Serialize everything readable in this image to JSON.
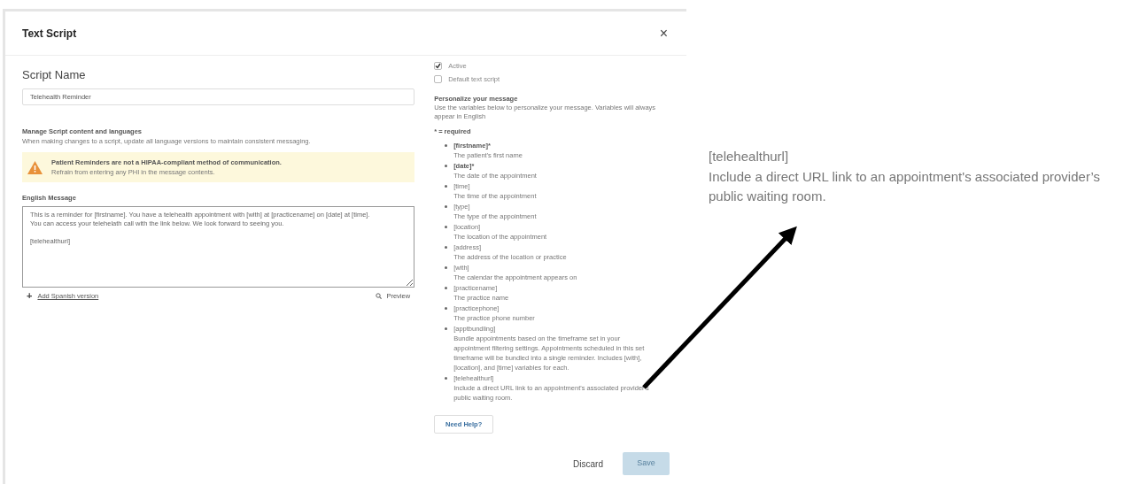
{
  "dialog": {
    "title": "Text Script",
    "close": "×"
  },
  "script_name": {
    "label": "Script Name",
    "value": "Telehealth Reminder"
  },
  "manage": {
    "title": "Manage Script content and languages",
    "text": "When making changes to a script, update all language versions to maintain consistent messaging."
  },
  "warning": {
    "title": "Patient Reminders are not a HIPAA-compliant method of communication.",
    "text": "Refrain from entering any PHI in the message contents."
  },
  "message": {
    "label": "English Message",
    "value": "This is a reminder for [firstname]. You have a telehealth appointment with [with] at [practicename] on [date] at [time].\nYou can access your telehelath call with the link below. We look forward to seeing you.\n\n[telehealthurl]"
  },
  "add_language": {
    "icon": "+",
    "label": "Add Spanish version"
  },
  "preview": "Preview",
  "options": [
    {
      "label": "Active",
      "checked": true
    },
    {
      "label": "Default text script",
      "checked": false
    }
  ],
  "personalize": {
    "title": "Personalize your message",
    "text": "Use the variables below to personalize your message. Variables will always appear in English",
    "required_note": "* = required"
  },
  "variables": [
    {
      "name": "[firstname]*",
      "required": true,
      "description": "The patient's first name"
    },
    {
      "name": "[date]*",
      "required": true,
      "description": "The date of the appointment"
    },
    {
      "name": "[time]",
      "required": false,
      "description": "The time of the appointment"
    },
    {
      "name": "[type]",
      "required": false,
      "description": "The type of the appointment"
    },
    {
      "name": "[location]",
      "required": false,
      "description": "The location of the appointment"
    },
    {
      "name": "[address]",
      "required": false,
      "description": "The address of the location or practice"
    },
    {
      "name": "[with]",
      "required": false,
      "description": "The calendar the appointment appears on"
    },
    {
      "name": "[practicename]",
      "required": false,
      "description": "The practice name"
    },
    {
      "name": "[practicephone]",
      "required": false,
      "description": "The practice phone number"
    },
    {
      "name": "[apptbundling]",
      "required": false,
      "description": "Bundle appointments based on the timeframe set in your appointment filtering settings. Appointments scheduled in this set timeframe will be bundled into a single reminder. Includes [with], [location], and [time] variables for each."
    },
    {
      "name": "[telehealthurl]",
      "required": false,
      "description": "Include a direct URL link to an appointment's associated provider's public waiting room."
    }
  ],
  "help_button": "Need Help?",
  "buttons": [
    {
      "label": "Discard",
      "kind": "secondary",
      "disabled": false
    },
    {
      "label": "Save",
      "kind": "primary",
      "disabled": true
    }
  ],
  "callout": {
    "name": "[telehealthurl]",
    "description": "Include a direct URL link to an appointment's associated provider’s public waiting room."
  }
}
